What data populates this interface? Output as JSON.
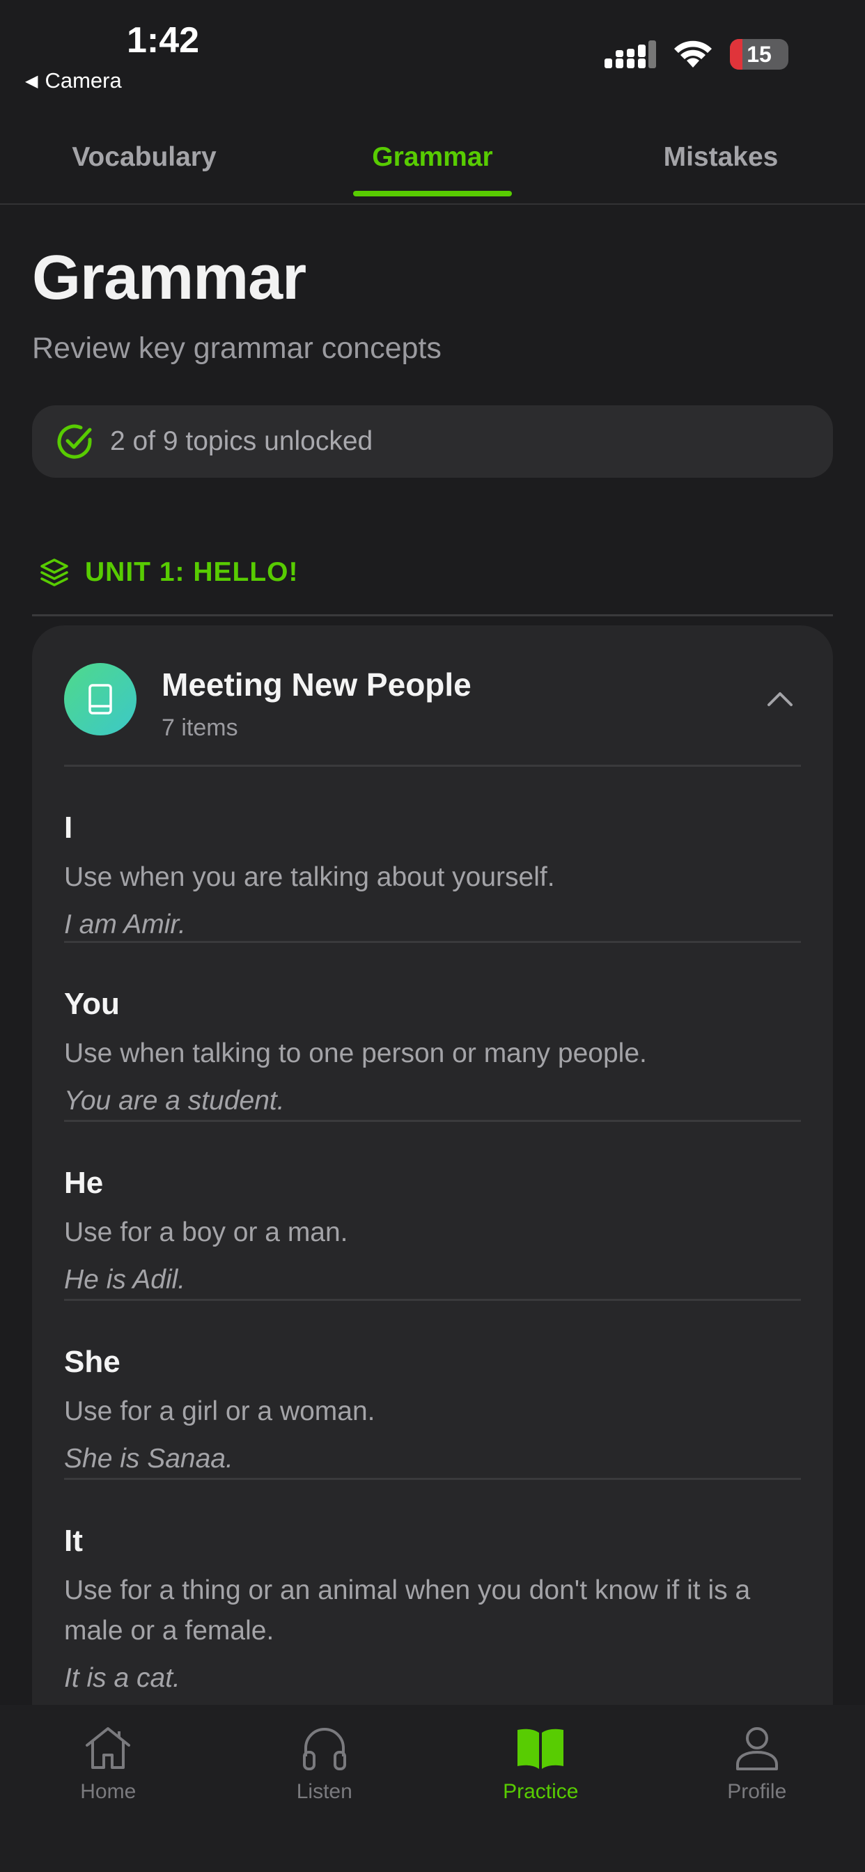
{
  "status_bar": {
    "time": "1:42",
    "back_label": "Camera",
    "battery": "15"
  },
  "tabs": [
    {
      "label": "Vocabulary",
      "active": false
    },
    {
      "label": "Grammar",
      "active": true
    },
    {
      "label": "Mistakes",
      "active": false
    }
  ],
  "header": {
    "title": "Grammar",
    "subtitle": "Review key grammar concepts",
    "progress_text": "2 of 9 topics unlocked"
  },
  "unit": {
    "title": "UNIT 1: HELLO!"
  },
  "topic": {
    "title": "Meeting New People",
    "count": "7 items",
    "items": [
      {
        "term": "I",
        "description": "Use when you are talking about yourself.",
        "example": "I am Amir."
      },
      {
        "term": "You",
        "description": "Use when talking to one person or many people.",
        "example": "You are a student."
      },
      {
        "term": "He",
        "description": "Use for a boy or a man.",
        "example": "He is Adil."
      },
      {
        "term": "She",
        "description": "Use for a girl or a woman.",
        "example": "She is Sanaa."
      },
      {
        "term": "It",
        "description": "Use for a thing or an animal when you don't know if it is a male or a female.",
        "example": "It is a cat."
      }
    ]
  },
  "bottom_nav": [
    {
      "label": "Home",
      "icon": "home-icon",
      "active": false
    },
    {
      "label": "Listen",
      "icon": "headphones-icon",
      "active": false
    },
    {
      "label": "Practice",
      "icon": "book-icon",
      "active": true
    },
    {
      "label": "Profile",
      "icon": "person-icon",
      "active": false
    }
  ],
  "colors": {
    "accent": "#58cc02",
    "background": "#1c1c1e",
    "card": "#272729"
  }
}
